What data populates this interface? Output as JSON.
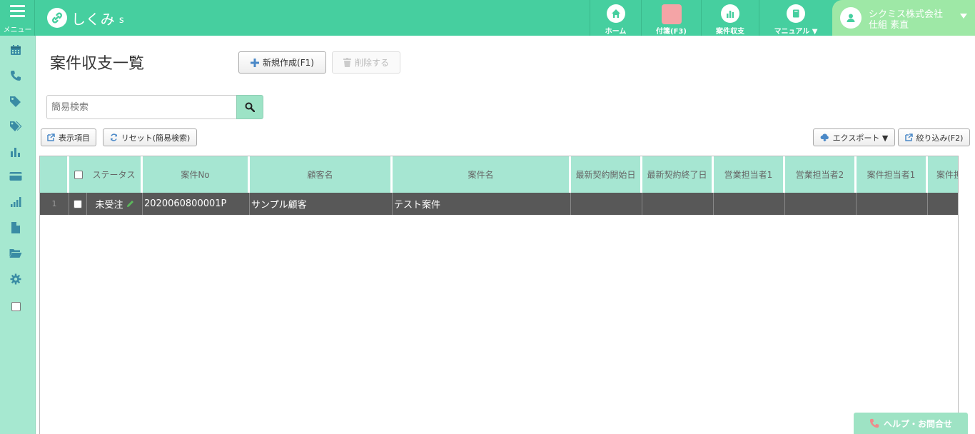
{
  "header": {
    "menu_label": "メニュー",
    "logo_text": "しくみ",
    "logo_sub": "s",
    "nav": [
      {
        "label": "ホーム",
        "icon": "home-icon"
      },
      {
        "label": "付箋(F3)",
        "icon": "sticky-note-icon"
      },
      {
        "label": "案件収支",
        "icon": "bar-chart-icon"
      },
      {
        "label": "マニュアル ▼",
        "icon": "book-icon"
      }
    ],
    "user": {
      "company": "シクミス株式会社",
      "name": "仕組 素直"
    }
  },
  "sidebar": {
    "icons": [
      "calendar-icon",
      "phone-icon",
      "tag-icon",
      "tags-icon",
      "bar-chart-icon",
      "credit-card-icon",
      "signal-icon",
      "file-icon",
      "folder-open-icon",
      "gear-icon",
      "checkbox-icon"
    ]
  },
  "page": {
    "title": "案件収支一覧",
    "new_button": "新規作成(F1)",
    "delete_button": "削除する",
    "search_placeholder": "簡易検索",
    "display_items_button": "表示項目",
    "reset_button": "リセット(簡易検索)",
    "export_button": "エクスポート ▼",
    "filter_button": "絞り込み(F2)"
  },
  "table": {
    "columns": [
      "ステータス",
      "案件No",
      "顧客名",
      "案件名",
      "最新契約開始日",
      "最新契約終了日",
      "営業担当者1",
      "営業担当者2",
      "案件担当者1",
      "案件担当"
    ],
    "rows": [
      {
        "num": "1",
        "status": "未受注",
        "no": "2020060800001P",
        "customer": "サンプル顧客",
        "project": "テスト案件",
        "start": "",
        "end": "",
        "sales1": "",
        "sales2": "",
        "pm1": "",
        "pm2": ""
      }
    ]
  },
  "help_button": "ヘルプ・お問合せ"
}
